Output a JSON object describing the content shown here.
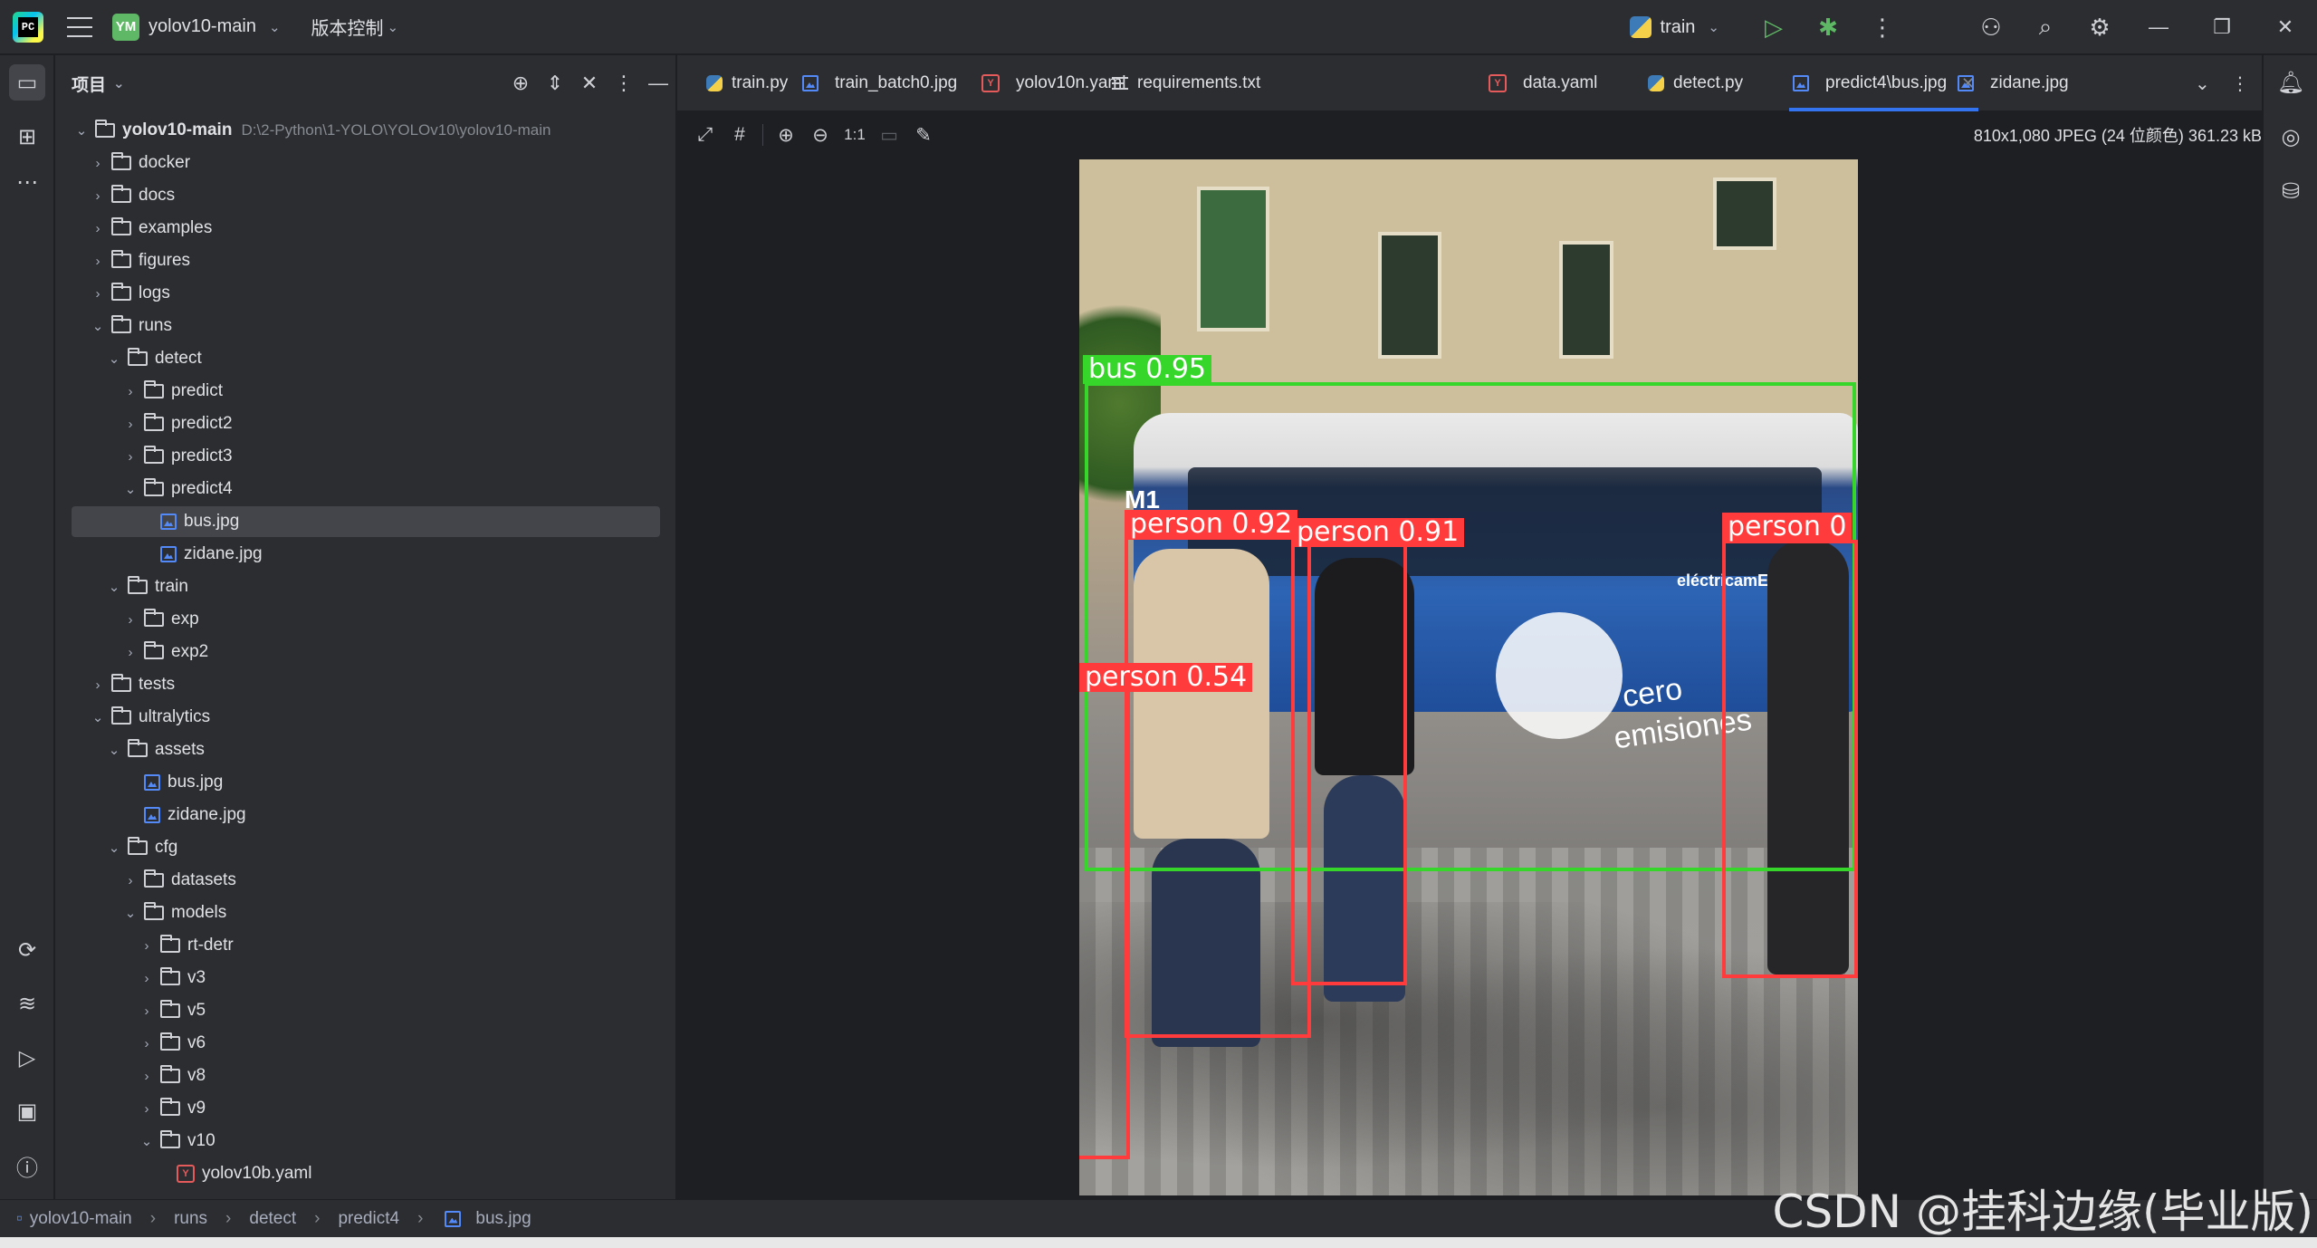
{
  "titlebar": {
    "logo_text": "PC",
    "project_badge": "YM",
    "project_name": "yolov10-main",
    "vcs_label": "版本控制",
    "run_config": "train"
  },
  "project_panel": {
    "title": "项目",
    "root_name": "yolov10-main",
    "root_path": "D:\\2-Python\\1-YOLO\\YOLOv10\\yolov10-main",
    "items": [
      {
        "label": "docker",
        "type": "folder",
        "depth": 1,
        "expanded": false
      },
      {
        "label": "docs",
        "type": "folder",
        "depth": 1,
        "expanded": false
      },
      {
        "label": "examples",
        "type": "folder",
        "depth": 1,
        "expanded": false
      },
      {
        "label": "figures",
        "type": "folder",
        "depth": 1,
        "expanded": false
      },
      {
        "label": "logs",
        "type": "folder",
        "depth": 1,
        "expanded": false
      },
      {
        "label": "runs",
        "type": "folder",
        "depth": 1,
        "expanded": true
      },
      {
        "label": "detect",
        "type": "folder",
        "depth": 2,
        "expanded": true
      },
      {
        "label": "predict",
        "type": "folder",
        "depth": 3,
        "expanded": false
      },
      {
        "label": "predict2",
        "type": "folder",
        "depth": 3,
        "expanded": false
      },
      {
        "label": "predict3",
        "type": "folder",
        "depth": 3,
        "expanded": false
      },
      {
        "label": "predict4",
        "type": "folder",
        "depth": 3,
        "expanded": true
      },
      {
        "label": "bus.jpg",
        "type": "image",
        "depth": 4,
        "selected": true
      },
      {
        "label": "zidane.jpg",
        "type": "image",
        "depth": 4
      },
      {
        "label": "train",
        "type": "folder",
        "depth": 2,
        "expanded": true
      },
      {
        "label": "exp",
        "type": "folder",
        "depth": 3,
        "expanded": false
      },
      {
        "label": "exp2",
        "type": "folder",
        "depth": 3,
        "expanded": false
      },
      {
        "label": "tests",
        "type": "folder",
        "depth": 1,
        "expanded": false
      },
      {
        "label": "ultralytics",
        "type": "folder",
        "depth": 1,
        "expanded": true
      },
      {
        "label": "assets",
        "type": "folder",
        "depth": 2,
        "expanded": true
      },
      {
        "label": "bus.jpg",
        "type": "image",
        "depth": 3
      },
      {
        "label": "zidane.jpg",
        "type": "image",
        "depth": 3
      },
      {
        "label": "cfg",
        "type": "folder",
        "depth": 2,
        "expanded": true
      },
      {
        "label": "datasets",
        "type": "folder",
        "depth": 3,
        "expanded": false
      },
      {
        "label": "models",
        "type": "folder",
        "depth": 3,
        "expanded": true
      },
      {
        "label": "rt-detr",
        "type": "folder",
        "depth": 4,
        "expanded": false
      },
      {
        "label": "v3",
        "type": "folder",
        "depth": 4,
        "expanded": false
      },
      {
        "label": "v5",
        "type": "folder",
        "depth": 4,
        "expanded": false
      },
      {
        "label": "v6",
        "type": "folder",
        "depth": 4,
        "expanded": false
      },
      {
        "label": "v8",
        "type": "folder",
        "depth": 4,
        "expanded": false
      },
      {
        "label": "v9",
        "type": "folder",
        "depth": 4,
        "expanded": false
      },
      {
        "label": "v10",
        "type": "folder",
        "depth": 4,
        "expanded": true
      },
      {
        "label": "yolov10b.yaml",
        "type": "yaml",
        "depth": 5
      }
    ]
  },
  "tabs": [
    {
      "label": "train.py",
      "icon": "python-icon"
    },
    {
      "label": "train_batch0.jpg",
      "icon": "image-icon"
    },
    {
      "label": "yolov10n.yaml",
      "icon": "yaml-icon"
    },
    {
      "label": "requirements.txt",
      "icon": "text-icon"
    },
    {
      "label": "data.yaml",
      "icon": "yaml-icon"
    },
    {
      "label": "detect.py",
      "icon": "python-icon"
    },
    {
      "label": "predict4\\bus.jpg",
      "icon": "image-icon",
      "active": true
    },
    {
      "label": "zidane.jpg",
      "icon": "image-icon"
    }
  ],
  "image_toolbar": {
    "actual_size_label": "1:1",
    "info": "810x1,080 JPEG (24 位颜色) 361.23 kB"
  },
  "detections": [
    {
      "label": "bus 0.95",
      "class": "bus",
      "confidence": 0.95,
      "color": "#37d62b"
    },
    {
      "label": "person 0.92",
      "class": "person",
      "confidence": 0.92,
      "color": "#ff3b3b"
    },
    {
      "label": "person 0.91",
      "class": "person",
      "confidence": 0.91,
      "color": "#ff3b3b"
    },
    {
      "label": "person 0",
      "class": "person",
      "color": "#ff3b3b"
    },
    {
      "label": "person 0.54",
      "class": "person",
      "confidence": 0.54,
      "color": "#ff3b3b"
    }
  ],
  "bus_text": {
    "route": "M1 SOL/SEVILLA",
    "brand": "eléctricamEMTe",
    "slogan1": "cero",
    "slogan2": "emisiones"
  },
  "statusbar": {
    "breadcrumbs": [
      "yolov10-main",
      "runs",
      "detect",
      "predict4",
      "bus.jpg"
    ]
  },
  "watermark": "CSDN @挂科边缘(毕业版)",
  "colors": {
    "accent": "#3574f0",
    "bg": "#1e1f22",
    "panel": "#2b2d30"
  }
}
